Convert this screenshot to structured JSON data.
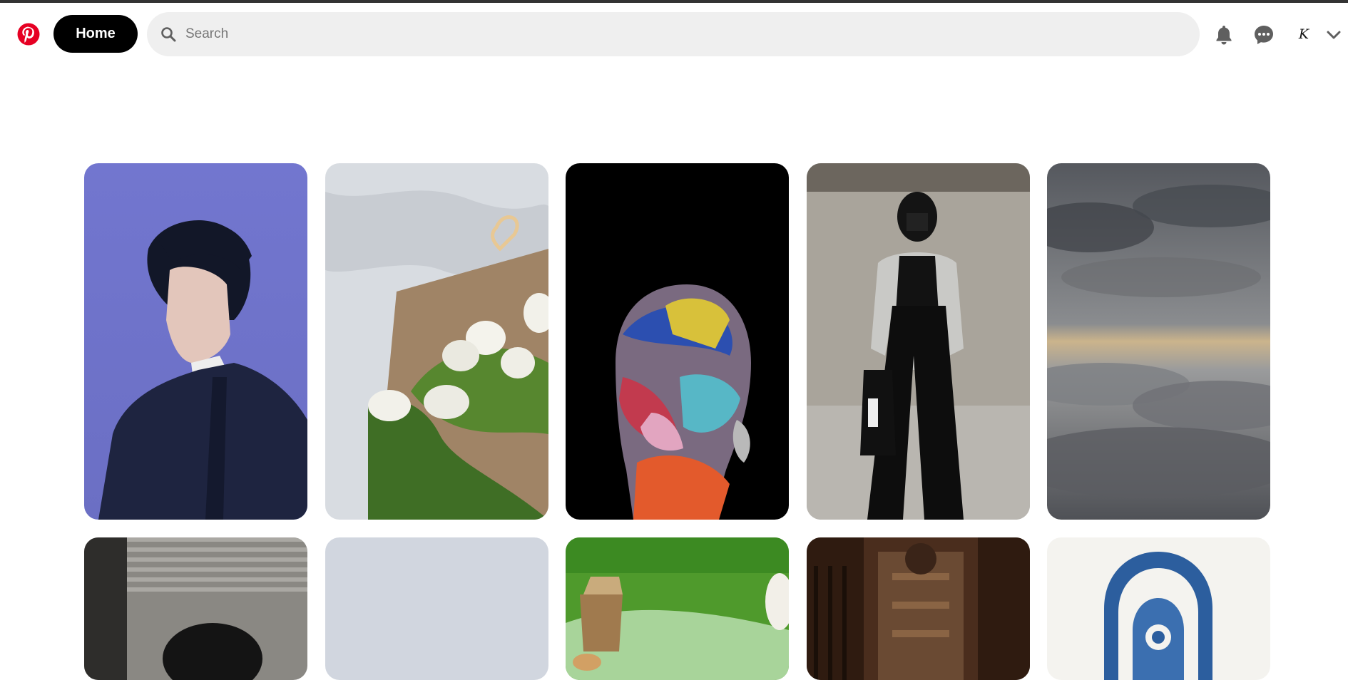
{
  "header": {
    "logo_icon": "pinterest-logo",
    "home_label": "Home",
    "search_placeholder": "Search",
    "search_value": "",
    "notifications_icon": "bell-icon",
    "messages_icon": "chat-bubble-icon",
    "avatar_initial": "K",
    "account_menu_icon": "chevron-down-icon"
  },
  "colors": {
    "brand_red": "#e60023",
    "home_bg": "#000000",
    "search_bg": "#efefef",
    "icon_gray": "#5f5f5f"
  },
  "pins": [
    {
      "name": "pin-portrait-man-blue",
      "colors": [
        "#7b7fd6",
        "#1f2540"
      ]
    },
    {
      "name": "pin-white-tulips",
      "colors": [
        "#d9dde2",
        "#4e7a2e"
      ]
    },
    {
      "name": "pin-abstract-painted-face",
      "colors": [
        "#000000",
        "#e85a5a"
      ]
    },
    {
      "name": "pin-woman-black-outfit",
      "colors": [
        "#a9a6a0",
        "#111111"
      ]
    },
    {
      "name": "pin-cloudy-sky",
      "colors": [
        "#5f6268",
        "#c9b38a"
      ]
    },
    {
      "name": "pin-man-by-blinds",
      "colors": [
        "#8c8a86",
        "#161616"
      ]
    },
    {
      "name": "pin-blank-placeholder",
      "colors": [
        "#d1d6df",
        "#d1d6df"
      ]
    },
    {
      "name": "pin-picnic-grass",
      "colors": [
        "#5aa033",
        "#9fd28f"
      ]
    },
    {
      "name": "pin-library-interior",
      "colors": [
        "#5a3622",
        "#2a170e"
      ]
    },
    {
      "name": "pin-blue-floral-motif",
      "colors": [
        "#f5f4f0",
        "#2e5fa0"
      ]
    }
  ]
}
